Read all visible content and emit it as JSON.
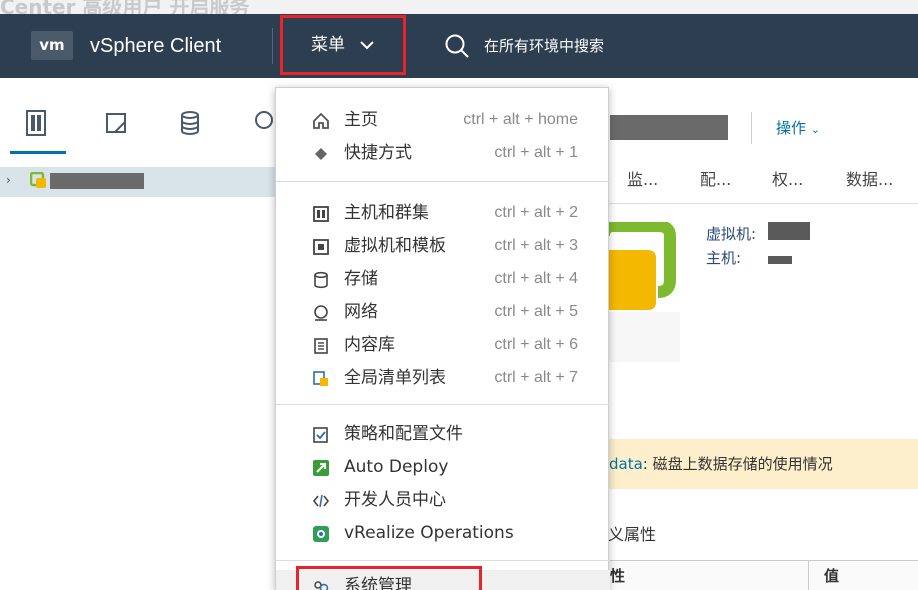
{
  "caption": "Center 高级用户 开启服务",
  "header": {
    "logo": "vm",
    "app_title": "vSphere Client",
    "menu_label": "菜单",
    "search_placeholder": "在所有环境中搜索"
  },
  "nav_icons": [
    "hosts-clusters-icon",
    "vms-templates-icon",
    "storage-icon",
    "network-icon"
  ],
  "tree": {
    "caret": "›",
    "item": "redacted"
  },
  "object": {
    "title": "redacted",
    "actions_label": "操作",
    "tabs": [
      "监...",
      "配...",
      "权...",
      "数据..."
    ],
    "info": {
      "vm_label": "虚拟机:",
      "host_label": "主机:"
    },
    "alert": {
      "link": "data",
      "text": ": 磁盘上数据存储的使用情况"
    },
    "section_title": "义属性",
    "table": {
      "col1": "性",
      "col2": "值"
    }
  },
  "menu": {
    "groups": [
      [
        {
          "icon": "home-icon",
          "label": "主页",
          "shortcut": "ctrl + alt + home"
        },
        {
          "icon": "shortcuts-icon",
          "label": "快捷方式",
          "shortcut": "ctrl + alt + 1"
        }
      ],
      [
        {
          "icon": "hosts-clusters-icon",
          "label": "主机和群集",
          "shortcut": "ctrl + alt + 2"
        },
        {
          "icon": "vms-templates-icon",
          "label": "虚拟机和模板",
          "shortcut": "ctrl + alt + 3"
        },
        {
          "icon": "storage-icon",
          "label": "存储",
          "shortcut": "ctrl + alt + 4"
        },
        {
          "icon": "network-icon",
          "label": "网络",
          "shortcut": "ctrl + alt + 5"
        },
        {
          "icon": "content-library-icon",
          "label": "内容库",
          "shortcut": "ctrl + alt + 6"
        },
        {
          "icon": "global-inventory-icon",
          "label": "全局清单列表",
          "shortcut": "ctrl + alt + 7"
        }
      ],
      [
        {
          "icon": "policies-icon",
          "label": "策略和配置文件",
          "shortcut": ""
        },
        {
          "icon": "auto-deploy-icon",
          "label": "Auto Deploy",
          "shortcut": ""
        },
        {
          "icon": "developer-center-icon",
          "label": "开发人员中心",
          "shortcut": ""
        },
        {
          "icon": "vrealize-icon",
          "label": "vRealize Operations",
          "shortcut": ""
        }
      ],
      [
        {
          "icon": "administration-icon",
          "label": "系统管理",
          "shortcut": ""
        }
      ]
    ]
  },
  "colors": {
    "header_bg": "#2c3e50",
    "highlight_box": "#e8242a",
    "link_blue": "#0072a3",
    "alert_bg": "#fdefcb"
  }
}
